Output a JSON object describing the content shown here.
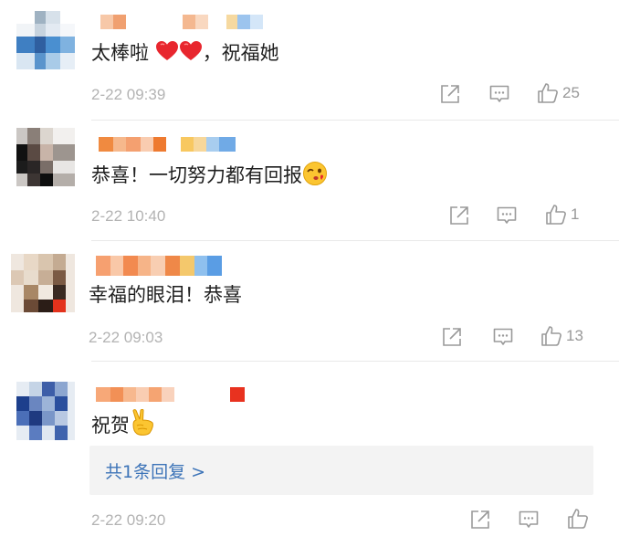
{
  "comments": [
    {
      "text": "太棒啦",
      "text_suffix": "，祝福她",
      "time": "2-22 09:39",
      "likes": "25",
      "icons": [
        "heart-emoji",
        "heart-emoji"
      ]
    },
    {
      "text": "恭喜！一切努力都有回报",
      "time": "2-22 10:40",
      "likes": "1",
      "icons": [
        "kissing-face-emoji"
      ]
    },
    {
      "text": "幸福的眼泪！恭喜",
      "time": "2-22 09:03",
      "likes": "13",
      "icons": []
    },
    {
      "text": "祝贺",
      "time": "2-22 09:20",
      "likes": "",
      "icons": [
        "victory-hand-emoji"
      ],
      "reply_link": "共1条回复 >"
    }
  ],
  "actions": [
    "share-icon",
    "comment-icon",
    "like-icon"
  ],
  "colors": {
    "reply_link": "#3d74b8",
    "time": "#b3b3b3",
    "icon": "#9a9a9a",
    "heart": "#e8262e"
  }
}
